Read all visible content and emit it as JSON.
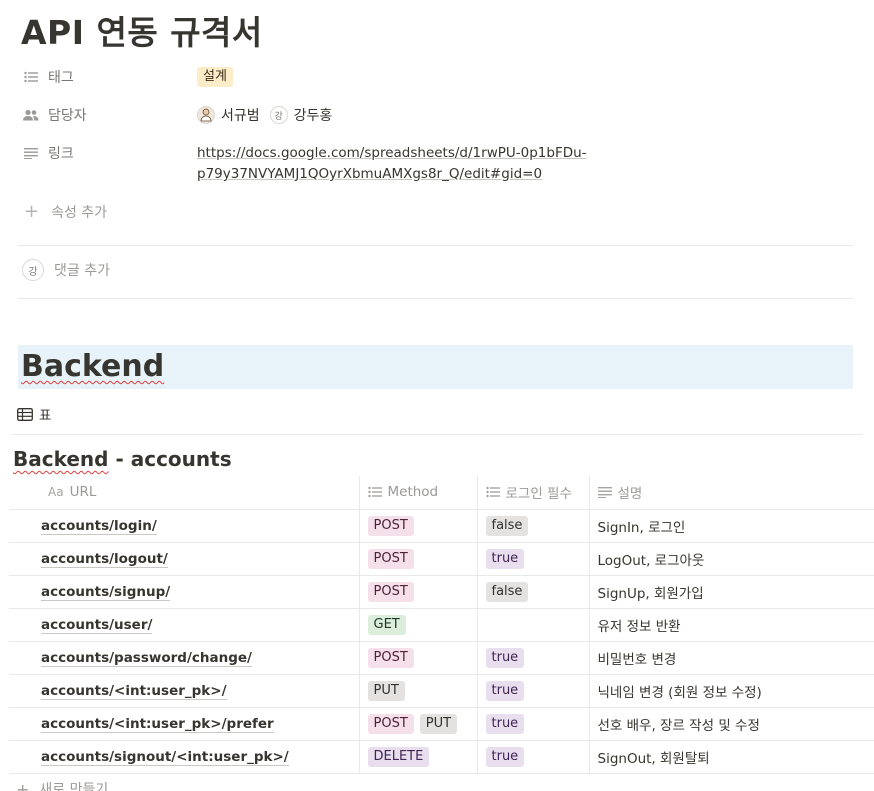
{
  "page": {
    "title": "API 연동 규격서"
  },
  "properties": {
    "tag": {
      "label": "태그",
      "value": "설계",
      "icon": "list-icon"
    },
    "assignees": {
      "label": "담당자",
      "icon": "people-icon",
      "people": [
        {
          "name": "서규범",
          "avatar": "photo"
        },
        {
          "name": "강두홍",
          "avatar": "강"
        }
      ]
    },
    "link": {
      "label": "링크",
      "icon": "text-lines-icon",
      "line1": "https://docs.google.com/spreadsheets/d/1rwPU-0p1bFDu-",
      "line2": "p79y37NVYAMJ1QOyrXbmuAMXgs8r_Q/edit#gid=0"
    },
    "add_label": "속성 추가"
  },
  "comment": {
    "avatar": "강",
    "placeholder": "댓글 추가"
  },
  "section": {
    "heading": "Backend"
  },
  "view": {
    "tab_label": "표",
    "icon": "table-icon"
  },
  "database": {
    "title_part1": "Backend",
    "title_part2": " - accounts",
    "columns": {
      "url": "URL",
      "url_icon": "Aa",
      "method": "Method",
      "login": "로그인 필수",
      "desc": "설명"
    },
    "rows": [
      {
        "url": "accounts/login/",
        "methods": [
          "POST"
        ],
        "login": "false",
        "desc": "SignIn, 로그인"
      },
      {
        "url": "accounts/logout/",
        "methods": [
          "POST"
        ],
        "login": "true",
        "desc": "LogOut, 로그아웃"
      },
      {
        "url": "accounts/signup/",
        "methods": [
          "POST"
        ],
        "login": "false",
        "desc": "SignUp, 회원가입"
      },
      {
        "url": "accounts/user/",
        "methods": [
          "GET"
        ],
        "login": "",
        "desc": "유저 정보 반환"
      },
      {
        "url": "accounts/password/change/",
        "methods": [
          "POST"
        ],
        "login": "true",
        "desc": "비밀번호 변경"
      },
      {
        "url": "accounts/<int:user_pk>/",
        "methods": [
          "PUT"
        ],
        "login": "true",
        "desc": "닉네임 변경 (회원 정보 수정)"
      },
      {
        "url": "accounts/<int:user_pk>/prefer",
        "methods": [
          "POST",
          "PUT"
        ],
        "login": "true",
        "desc": "선호 배우, 장르 작성 및 수정"
      },
      {
        "url": "accounts/signout/<int:user_pk>/",
        "methods": [
          "DELETE"
        ],
        "login": "true",
        "desc": "SignOut, 회원탈퇴"
      }
    ],
    "new_row_label": "새로 만들기"
  }
}
